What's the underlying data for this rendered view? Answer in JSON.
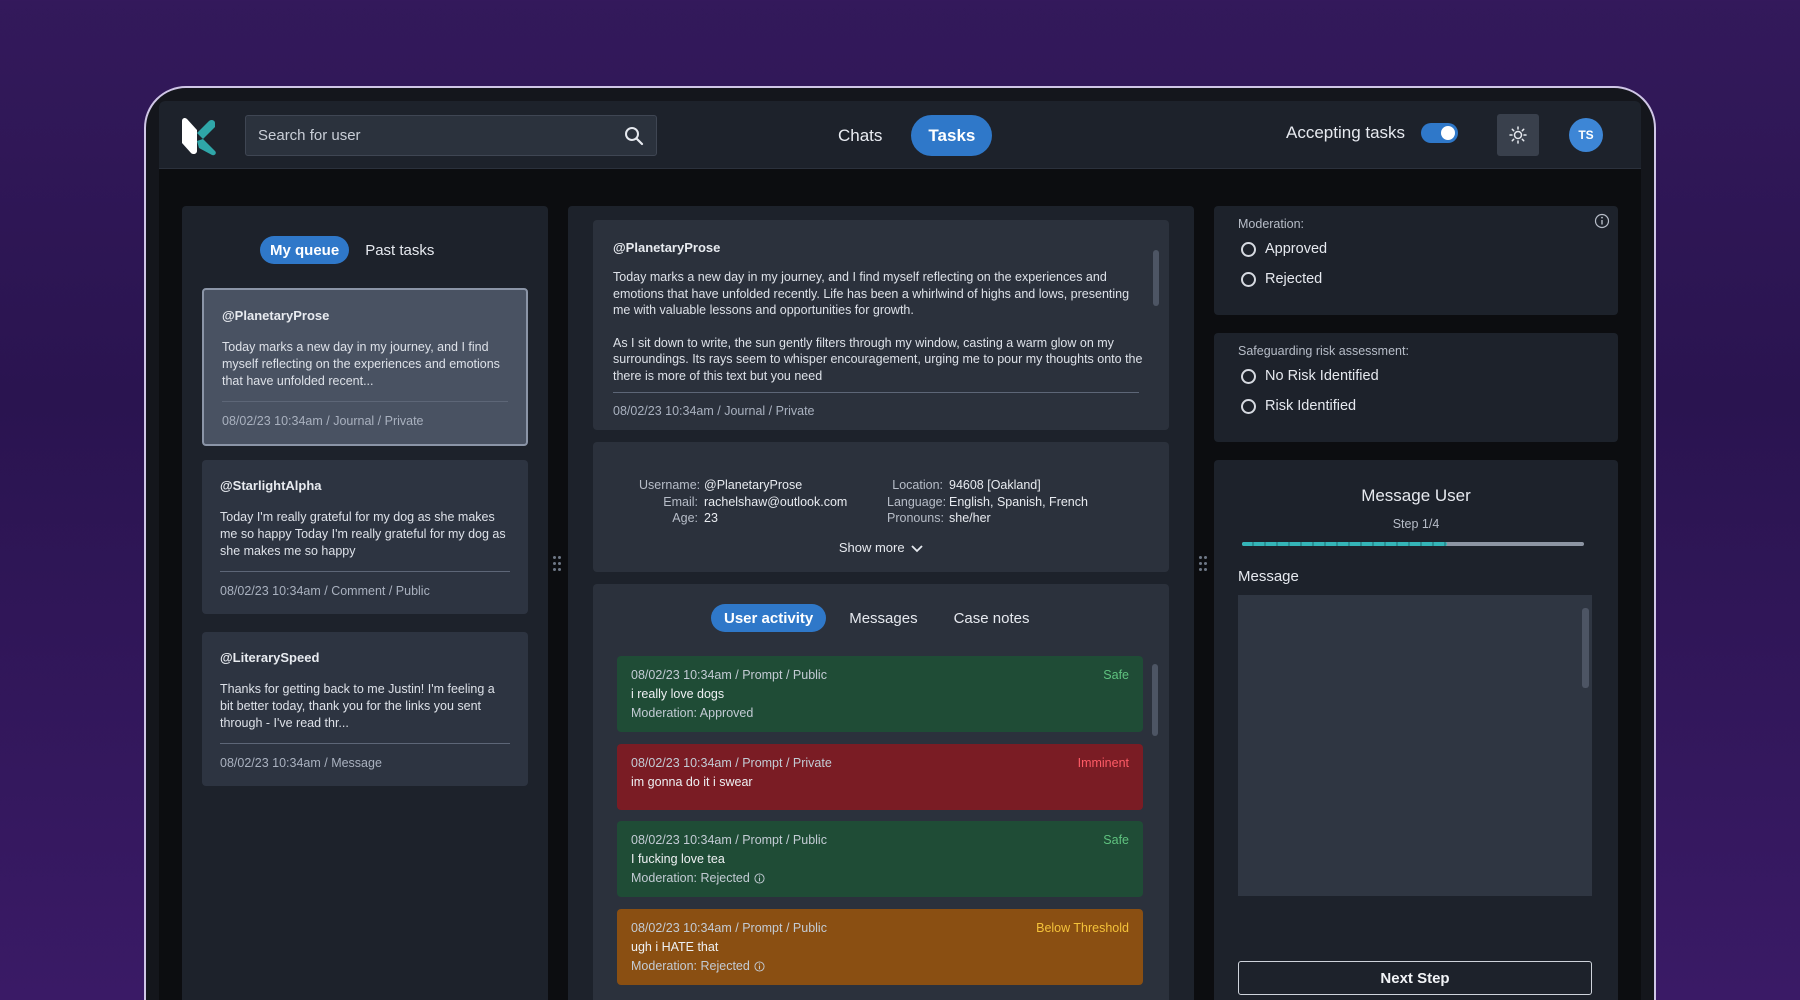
{
  "topbar": {
    "search_placeholder": "Search for user",
    "nav": [
      {
        "label": "Chats"
      },
      {
        "label": "Tasks"
      }
    ],
    "accepting_label": "Accepting tasks",
    "avatar_initials": "TS"
  },
  "queue": {
    "tabs": [
      {
        "label": "My queue"
      },
      {
        "label": "Past tasks"
      }
    ],
    "items": [
      {
        "user": "@PlanetaryProse",
        "text": "Today marks a new day in my journey, and I find myself reflecting on the experiences and emotions that have unfolded recent...",
        "meta": "08/02/23 10:34am / Journal / Private"
      },
      {
        "user": "@StarlightAlpha",
        "text": "Today I'm really grateful for my dog as she makes me so happy Today I'm really grateful for my dog as she makes me so happy",
        "meta": "08/02/23 10:34am / Comment / Public"
      },
      {
        "user": "@LiterarySpeed",
        "text": "Thanks for getting back to me Justin! I'm feeling a bit better today, thank you for the links you sent through - I've read thr...",
        "meta": "08/02/23 10:34am / Message"
      }
    ]
  },
  "post": {
    "user": "@PlanetaryProse",
    "paragraphs": [
      "Today marks a new day in my journey, and I find myself reflecting on the experiences and emotions that have unfolded recently. Life has been a whirlwind of highs and lows, presenting me with valuable lessons and opportunities for growth.",
      "As I sit down to write, the sun gently filters through my window, casting a warm glow on my surroundings. Its rays seem to whisper encouragement, urging me to pour my thoughts onto the there is more of this text but you need"
    ],
    "meta": "08/02/23 10:34am / Journal / Private"
  },
  "user_info": {
    "left": [
      {
        "label": "Username:",
        "value": "@PlanetaryProse"
      },
      {
        "label": "Email:",
        "value": "rachelshaw@outlook.com"
      },
      {
        "label": "Age:",
        "value": "23"
      }
    ],
    "right": [
      {
        "label": "Location:",
        "value": "94608 [Oakland]"
      },
      {
        "label": "Language:",
        "value": "English, Spanish, French"
      },
      {
        "label": "Pronouns:",
        "value": "she/her"
      }
    ],
    "show_more": "Show more"
  },
  "activity": {
    "tabs": [
      {
        "label": "User activity"
      },
      {
        "label": "Messages"
      },
      {
        "label": "Case notes"
      }
    ],
    "items": [
      {
        "meta": "08/02/23 10:34am / Prompt / Public",
        "status": "Safe",
        "text": "i really love dogs",
        "moderation": "Moderation: Approved"
      },
      {
        "meta": "08/02/23 10:34am / Prompt / Private",
        "status": "Imminent",
        "text": "im gonna do it i swear",
        "moderation": ""
      },
      {
        "meta": "08/02/23 10:34am / Prompt / Public",
        "status": "Safe",
        "text": "I fucking love tea",
        "moderation": "Moderation: Rejected"
      },
      {
        "meta": "08/02/23 10:34am / Prompt / Public",
        "status": "Below Threshold",
        "text": "ugh i HATE that",
        "moderation": "Moderation: Rejected"
      }
    ],
    "colors": {
      "safe": "#1f4c36",
      "imminent": "#7a1c24",
      "below": "#8a4f12"
    }
  },
  "moderation": {
    "label": "Moderation:",
    "options": [
      {
        "label": "Approved"
      },
      {
        "label": "Rejected"
      }
    ]
  },
  "safeguarding": {
    "label": "Safeguarding risk assessment:",
    "options": [
      {
        "label": "No Risk Identified"
      },
      {
        "label": "Risk Identified"
      }
    ]
  },
  "message_user": {
    "title": "Message User",
    "step": "Step 1/4",
    "progress_fraction": 0.6,
    "message_label": "Message",
    "message_value": "",
    "next_button": "Next Step"
  },
  "colors": {
    "accent": "#2f78c9",
    "logo_teal": "#2fa6a8"
  }
}
